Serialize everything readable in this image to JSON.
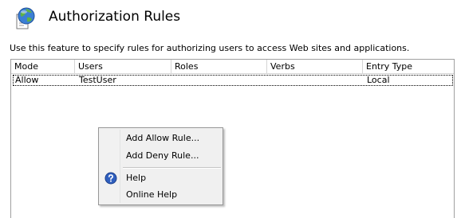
{
  "header": {
    "icon": "globe-document-icon",
    "title": "Authorization Rules"
  },
  "description": "Use this feature to specify rules for authorizing users to access Web sites and applications.",
  "grid": {
    "columns": [
      "Mode",
      "Users",
      "Roles",
      "Verbs",
      "Entry Type"
    ],
    "rows": [
      {
        "mode": "Allow",
        "users": "TestUser",
        "roles": "",
        "verbs": "",
        "entry_type": "Local"
      }
    ]
  },
  "context_menu": {
    "items": [
      {
        "label": "Add Allow Rule...",
        "icon": ""
      },
      {
        "label": "Add Deny Rule...",
        "icon": ""
      },
      {
        "label": "Help",
        "icon": "help-icon"
      },
      {
        "label": "Online Help",
        "icon": ""
      }
    ]
  },
  "colors": {
    "help_icon": "#2f5fbf",
    "grid_border": "#a0a0a0",
    "menu_background": "#f0f0f0"
  }
}
